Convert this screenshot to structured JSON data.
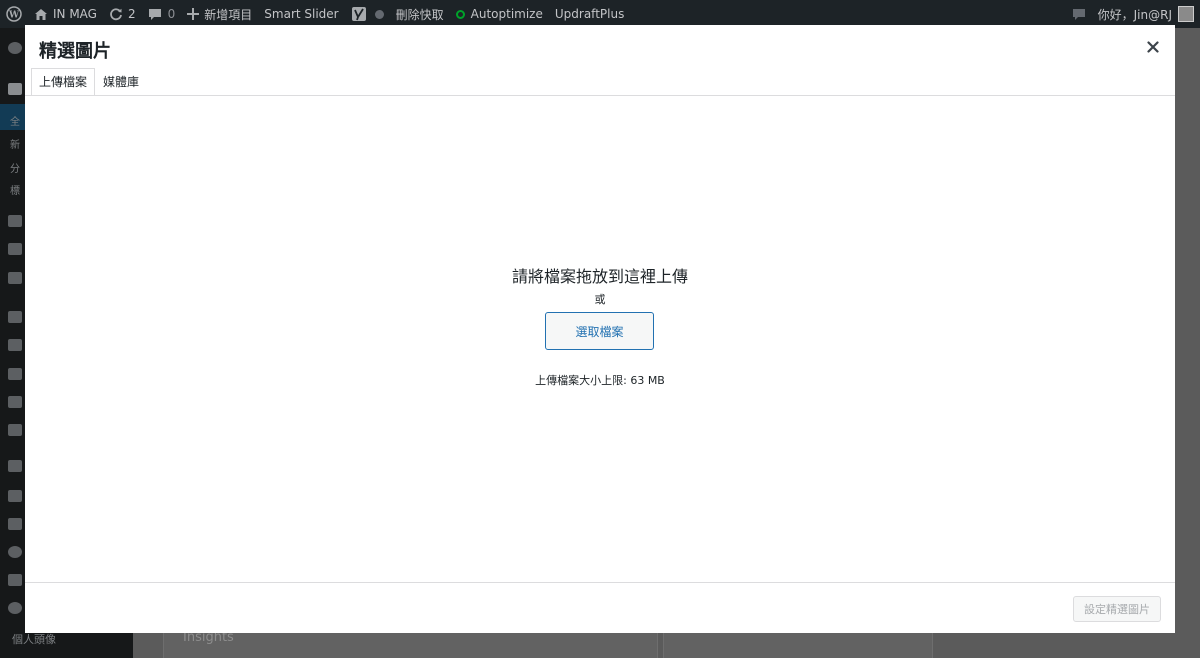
{
  "adminbar": {
    "site_name": "IN MAG",
    "updates_count": "2",
    "comments_count": "0",
    "new_item": "新增項目",
    "smart_slider": "Smart Slider",
    "clear_cache": "刪除快取",
    "autoptimize": "Autoptimize",
    "updraftplus": "UpdraftPlus",
    "greeting": "你好，Jin@RJ"
  },
  "background": {
    "sidebar_items": [
      "全",
      "新",
      "分",
      "標"
    ],
    "profile_label": "個人頭像",
    "insights_label": "Insights"
  },
  "modal": {
    "title": "精選圖片",
    "tabs": [
      {
        "label": "上傳檔案",
        "active": true
      },
      {
        "label": "媒體庫",
        "active": false
      }
    ],
    "drop_instructions": "請將檔案拖放到這裡上傳",
    "or_label": "或",
    "select_files_label": "選取檔案",
    "max_upload_size": "上傳檔案大小上限: 63 MB",
    "set_featured_label": "設定精選圖片"
  },
  "colors": {
    "admin_bar_bg": "#1d2327",
    "accent": "#2271b1",
    "autoptimize_status": "#00a32a"
  }
}
